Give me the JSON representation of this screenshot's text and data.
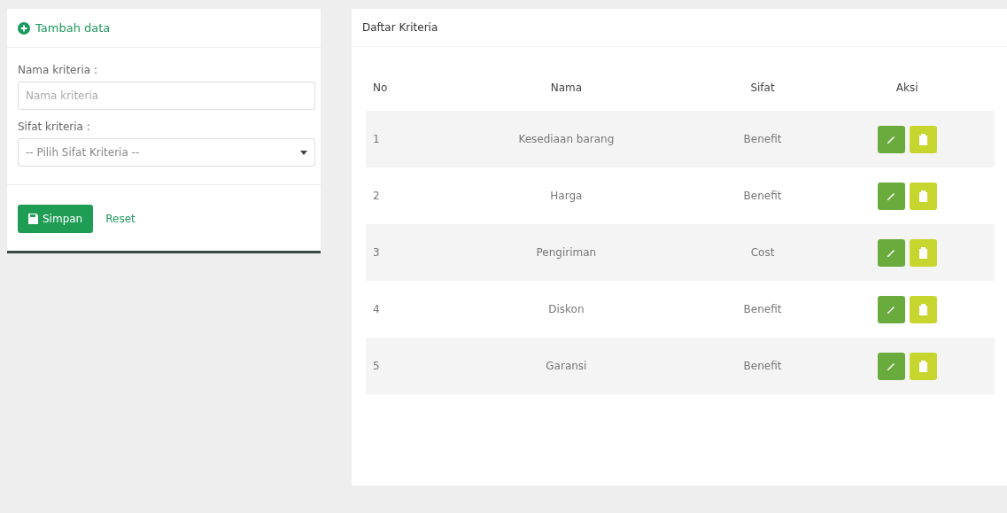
{
  "form": {
    "title": "Tambah data",
    "fields": [
      {
        "kind": "text",
        "label": "Nama kriteria :",
        "placeholder": "Nama kriteria"
      },
      {
        "kind": "select",
        "label": "Sifat kriteria :",
        "value": "-- Pilih Sifat Kriteria --"
      }
    ],
    "save_button": "Simpan",
    "reset_link": "Reset"
  },
  "list": {
    "title": "Daftar Kriteria",
    "table": {
      "columns": [
        "No",
        "Nama",
        "Sifat",
        "Aksi"
      ],
      "rows": [
        {
          "no": "1",
          "name": "Kesediaan barang",
          "type": "Benefit"
        },
        {
          "no": "2",
          "name": "Harga",
          "type": "Benefit"
        },
        {
          "no": "3",
          "name": "Pengiriman",
          "type": "Cost"
        },
        {
          "no": "4",
          "name": "Diskon",
          "type": "Benefit"
        },
        {
          "no": "5",
          "name": "Garansi",
          "type": "Benefit"
        }
      ]
    }
  }
}
